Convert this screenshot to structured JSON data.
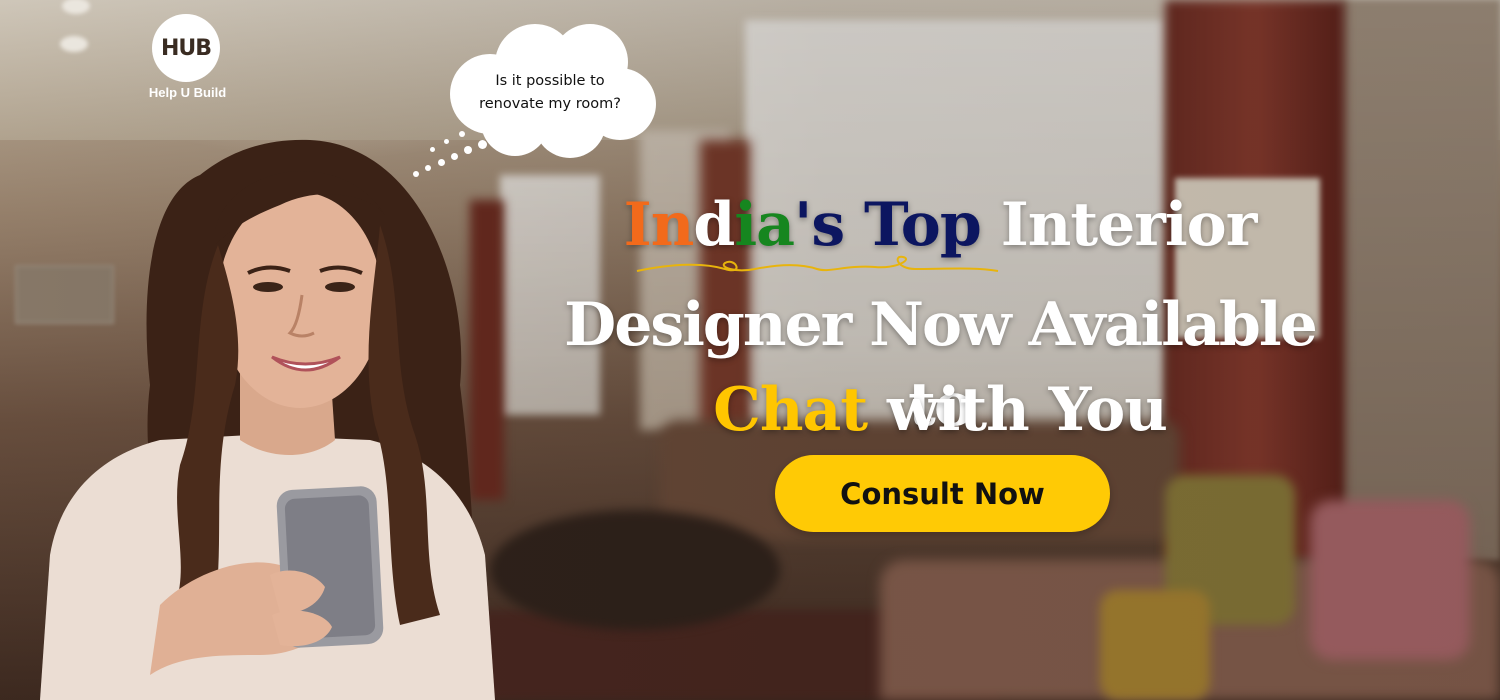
{
  "brand": {
    "logo_text": "HUB",
    "tagline": "Help U Build"
  },
  "thought_bubble": {
    "line1": "Is it possible to",
    "line2": "renovate my room?"
  },
  "headline": {
    "line1": {
      "part_in": "In",
      "part_d": "d",
      "part_ia": "ia",
      "part_s": "'s",
      "part_top": "Top",
      "part_interior": "Interior"
    },
    "line2": "Designer Now Available to",
    "line3": {
      "part_chat": "Chat",
      "part_rest": "with You"
    }
  },
  "cta": {
    "label": "Consult Now"
  },
  "colors": {
    "saffron": "#f26a1b",
    "green": "#16861f",
    "navy": "#0c1660",
    "yellow": "#ffc600",
    "button": "#ffca05"
  }
}
